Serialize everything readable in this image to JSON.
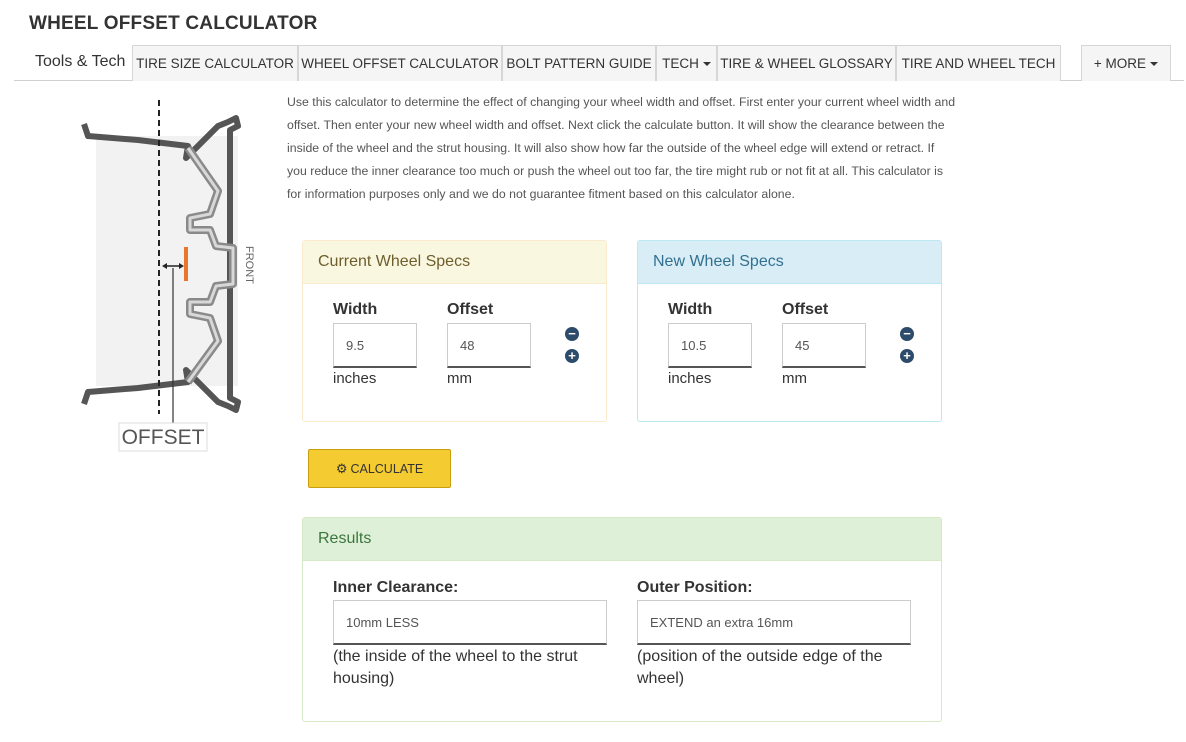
{
  "page_title": "WHEEL OFFSET CALCULATOR",
  "nav": {
    "brand": "Tools & Tech",
    "tabs": [
      {
        "label": "TIRE SIZE CALCULATOR"
      },
      {
        "label": "WHEEL OFFSET CALCULATOR"
      },
      {
        "label": "BOLT PATTERN GUIDE"
      },
      {
        "label": "TECH"
      },
      {
        "label": "TIRE & WHEEL GLOSSARY"
      },
      {
        "label": "TIRE AND WHEEL TECH"
      }
    ],
    "more_label": "+ MORE"
  },
  "illustration": {
    "front_label": "FRONT",
    "offset_label": "OFFSET"
  },
  "description": "Use this calculator to determine the effect of changing your wheel width and offset. First enter your current wheel width and offset. Then enter your new wheel width and offset. Next click the calculate button. It will show the clearance between the inside of the wheel and the strut housing. It will also show how far the outside of the wheel edge will extend or retract. If you reduce the inner clearance too much or push the wheel out too far, the tire might rub or not fit at all. This calculator is for information purposes only and we do not guarantee fitment based on this calculator alone.",
  "current": {
    "heading": "Current Wheel Specs",
    "width_label": "Width",
    "offset_label": "Offset",
    "width_value": "9.5",
    "offset_value": "48",
    "width_unit": "inches",
    "offset_unit": "mm"
  },
  "new": {
    "heading": "New Wheel Specs",
    "width_label": "Width",
    "offset_label": "Offset",
    "width_value": "10.5",
    "offset_value": "45",
    "width_unit": "inches",
    "offset_unit": "mm"
  },
  "stepper": {
    "minus_icon": "minus-circle-icon",
    "plus_icon": "plus-circle-icon"
  },
  "calculate": {
    "label": "CALCULATE",
    "icon": "gear-icon",
    "color": "#f4cb30"
  },
  "results": {
    "heading": "Results",
    "inner_label": "Inner Clearance:",
    "inner_value": "10mm LESS",
    "inner_note": "(the inside of the wheel to the strut housing)",
    "outer_label": "Outer Position:",
    "outer_value": "EXTEND an extra 16mm",
    "outer_note": "(position of the outside edge of the wheel)"
  }
}
